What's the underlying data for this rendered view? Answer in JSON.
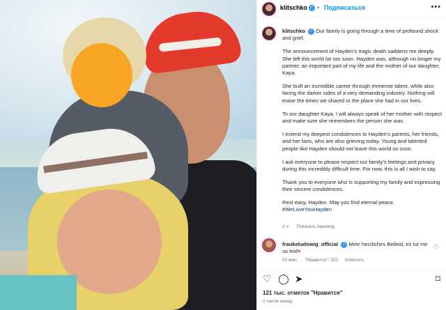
{
  "post": {
    "username": "klitschko",
    "separator": "•",
    "follow_label": "Подписаться",
    "more_icon": "more-horizontal-icon"
  },
  "caption": {
    "username": "klitschko",
    "paragraphs": [
      "Our family is going through a time of profound shock and grief.",
      "The announcement of Hayden's tragic death saddens me deeply. She left this world far too soon. Hayden was, although no longer my partner, an important part of my life and the mother of our daughter, Kaya.",
      "She built an incredible career through immense talent, while also facing the darker sides of a very demanding industry. Nothing will erase the times we shared or the place she had in our lives.",
      "To our daughter Kaya, I will always speak of her mother with respect and make sure she remembers the person she was.",
      "I extend my deepest condolences to Hayden's parents, her friends, and her fans, who are also grieving today. Young and talented people like Hayden should not leave this world so soon.",
      "I ask everyone to please respect our family's feelings and privacy during this incredibly difficult time. For now, this is all I wish to say.",
      "Thank you to everyone who is supporting my family and expressing their sincere condolences.",
      "Rest easy, Hayden. May you find eternal peace."
    ],
    "hashtag": "#WeLoveYouHayden",
    "age": "2 ч.",
    "translate_label": "Показать перевод"
  },
  "comment": {
    "username": "fraukeludowig_official",
    "text": "Mein herzliches Beileid, es tut mir so leid",
    "emoji": "♥",
    "age": "50 мин.",
    "likes": "\"Нравится\": 152",
    "reply_label": "Ответить"
  },
  "actions": {
    "like": "♡",
    "comment": "◯",
    "share": "➤",
    "save": "⌑"
  },
  "footer": {
    "likes_text": "121 тыс. отметок \"Нравится\"",
    "time_text": "2 часов назад"
  },
  "colors": {
    "accent_blue": "#0095f6",
    "verified_blue": "#3897f0",
    "hashtag": "#00376b",
    "heart": "#ed4956",
    "blur_circle": "#f8a523",
    "cap_red": "#e43a2c"
  }
}
